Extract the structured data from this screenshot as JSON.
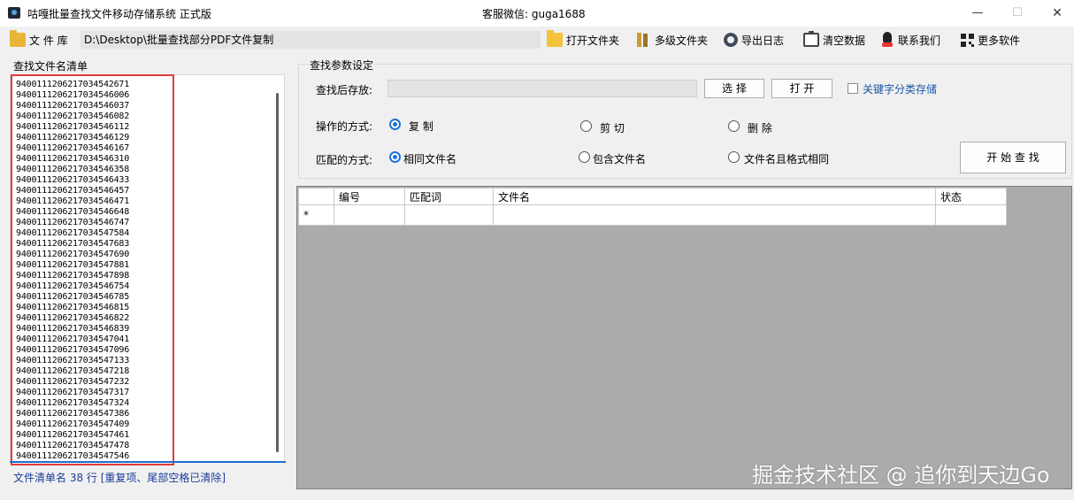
{
  "window": {
    "title": "咕嘎批量查找文件移动存储系统  正式版",
    "support": "客服微信: guga1688",
    "min": "—",
    "max": "☐",
    "close": "✕"
  },
  "toolbar": {
    "library_label": "文 件 库",
    "path": "D:\\Desktop\\批量查找部分PDF文件复制",
    "open_folder": "打开文件夹",
    "multi_folder": "多级文件夹",
    "export_log": "导出日志",
    "clear_data": "清空数据",
    "contact": "联系我们",
    "more_software": "更多软件"
  },
  "left_panel": {
    "title": "查找文件名清单",
    "items": [
      "9400111206217034542671",
      "9400111206217034546006",
      "9400111206217034546037",
      "9400111206217034546082",
      "9400111206217034546112",
      "9400111206217034546129",
      "9400111206217034546167",
      "9400111206217034546310",
      "9400111206217034546358",
      "9400111206217034546433",
      "9400111206217034546457",
      "9400111206217034546471",
      "9400111206217034546648",
      "9400111206217034546747",
      "9400111206217034547584",
      "9400111206217034547683",
      "9400111206217034547690",
      "9400111206217034547881",
      "9400111206217034547898",
      "9400111206217034546754",
      "9400111206217034546785",
      "9400111206217034546815",
      "9400111206217034546822",
      "9400111206217034546839",
      "9400111206217034547041",
      "9400111206217034547096",
      "9400111206217034547133",
      "9400111206217034547218",
      "9400111206217034547232",
      "9400111206217034547317",
      "9400111206217034547324",
      "9400111206217034547386",
      "9400111206217034547409",
      "9400111206217034547461",
      "9400111206217034547478",
      "9400111206217034547546"
    ],
    "status": "文件清单名 38 行  [重复项、尾部空格已清除]"
  },
  "params": {
    "group_title": "查找参数设定",
    "save_label": "查找后存放:",
    "save_path": "",
    "select_button": "选 择",
    "open_button": "打 开",
    "keyword_checkbox": "关键字分类存储",
    "keyword_checked": false,
    "operation_label": "操作的方式:",
    "op_copy": "复 制",
    "op_cut": "剪 切",
    "op_delete": "删 除",
    "operation_selected": "复 制",
    "match_label": "匹配的方式:",
    "match_same": "相同文件名",
    "match_contains": "包含文件名",
    "match_same_format": "文件名且格式相同",
    "match_selected": "相同文件名",
    "start_button": "开 始 查 找"
  },
  "grid": {
    "columns": [
      "编号",
      "匹配词",
      "文件名",
      "状态"
    ],
    "new_row_marker": "*"
  },
  "watermark": "掘金技术社区 @ 追你到天边Go"
}
